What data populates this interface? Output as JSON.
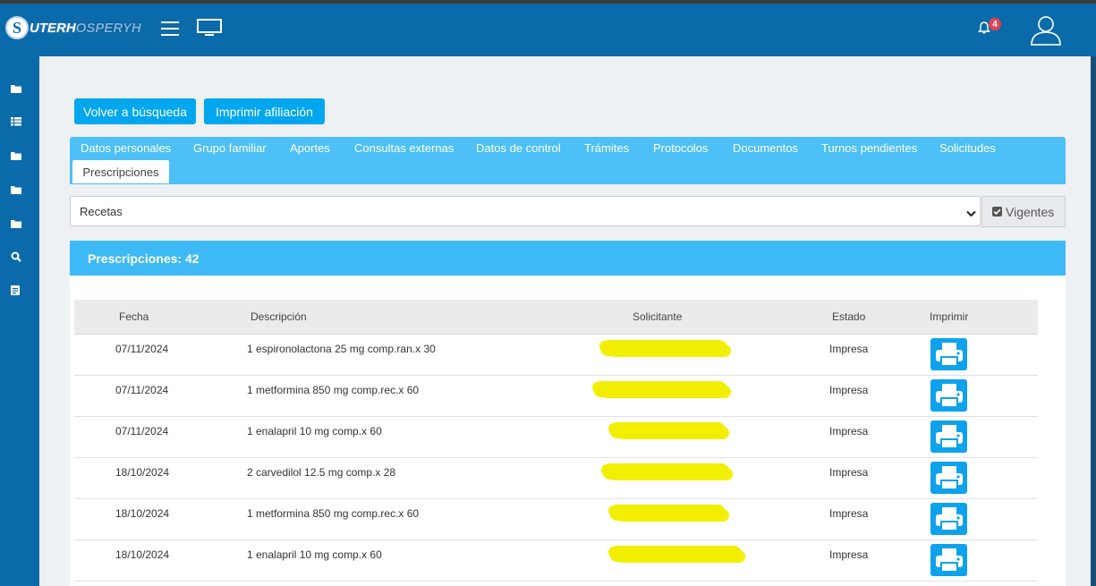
{
  "header": {
    "logo_main": "UTERH",
    "logo_secondary": "OSPERYH",
    "logo_initial": "S",
    "notification_count": "4"
  },
  "actions": {
    "back_label": "Volver a búsqueda",
    "print_affiliation_label": "Imprimir afiliación"
  },
  "tabs": [
    {
      "label": "Datos personales"
    },
    {
      "label": "Grupo familiar"
    },
    {
      "label": "Aportes"
    },
    {
      "label": "Consultas externas"
    },
    {
      "label": "Datos de control"
    },
    {
      "label": "Trámites"
    },
    {
      "label": "Protocolos"
    },
    {
      "label": "Documentos"
    },
    {
      "label": "Turnos pendientes"
    },
    {
      "label": "Solicitudes"
    }
  ],
  "active_tab": {
    "label": "Prescripciones"
  },
  "filter": {
    "selected": "Recetas",
    "vigentes_label": "Vigentes",
    "vigentes_checked": true
  },
  "panel": {
    "title": "Prescripciones: 42"
  },
  "table": {
    "headers": [
      "Fecha",
      "Descripción",
      "Solicitante",
      "Estado",
      "Imprimir"
    ],
    "rows": [
      {
        "fecha": "07/11/2024",
        "descripcion": "1 espironolactona 25 mg comp.ran.x 30",
        "estado": "Impresa"
      },
      {
        "fecha": "07/11/2024",
        "descripcion": "1 metformina 850 mg comp.rec.x 60",
        "estado": "Impresa"
      },
      {
        "fecha": "07/11/2024",
        "descripcion": "1 enalapril 10 mg comp.x 60",
        "estado": "Impresa"
      },
      {
        "fecha": "18/10/2024",
        "descripcion": "2 carvedilol 12.5 mg comp.x 28",
        "estado": "Impresa"
      },
      {
        "fecha": "18/10/2024",
        "descripcion": "1 metformina 850 mg comp.rec.x 60",
        "estado": "Impresa"
      },
      {
        "fecha": "18/10/2024",
        "descripcion": "1 enalapril 10 mg comp.x 60",
        "estado": "Impresa"
      }
    ]
  },
  "colors": {
    "topbar": "#0b6aa9",
    "accent": "#00a6ee",
    "tabs": "#4cc0f7",
    "redaction": "#f1ee00",
    "badge": "#e3434f"
  }
}
